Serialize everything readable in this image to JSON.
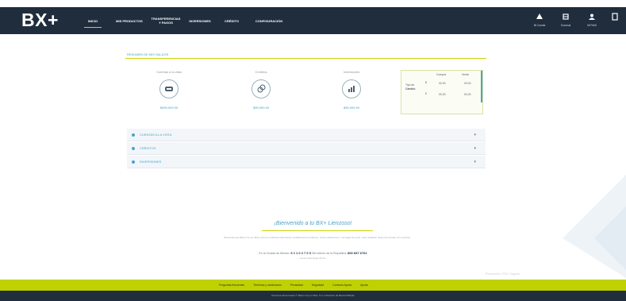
{
  "header": {
    "logo": "BX+",
    "nav": [
      {
        "label": "INICIO"
      },
      {
        "label": "MIS PRODUCTOS"
      },
      {
        "label": "TRANSFERENCIAS Y PAGOS"
      },
      {
        "label": "INVERSIONES"
      },
      {
        "label": "CRÉDITO"
      },
      {
        "label": "CONFIGURACIÓN"
      }
    ],
    "icons": [
      {
        "icon": "user-icon",
        "label": "Mi Cuenta"
      },
      {
        "icon": "building-icon",
        "label": "Sucursal"
      },
      {
        "icon": "profile-icon",
        "label": "Mi Perfil"
      },
      {
        "icon": "exit-icon",
        "label": ""
      }
    ]
  },
  "summary": {
    "title": "RESUMEN DE MIS SALDOS",
    "stats": [
      {
        "label": "Cuentas a la vista",
        "value": "$999,999.99",
        "icon": "wallet-icon"
      },
      {
        "label": "Créditos",
        "value": "$99,999.99",
        "icon": "coins-icon"
      },
      {
        "label": "Inversiones",
        "value": "$99,999.99",
        "icon": "chart-icon"
      }
    ],
    "table": {
      "col1": "Compra",
      "col2": "Venta",
      "row_label1": "Tipo de",
      "row_label2": "Cambio",
      "cur1": "$",
      "cur2": "€",
      "buy1": "00.00",
      "sell1": "00.00",
      "buy2": "00.00",
      "sell2": "00.00"
    }
  },
  "accordion": [
    {
      "label": "CUENTAS A LA VISTA"
    },
    {
      "label": "CRÉDITOS"
    },
    {
      "label": "INVERSIONES"
    }
  ],
  "footer": {
    "welcome": "¡Bienvenido a tu BX+ Lienzoso!",
    "disclaimer": "Recuerda que Banco Ve por Más nunca te solicitará información confidencial por teléfono, correo electrónico o mensajes de texto. Ante cualquier duda comunícate con nosotros.",
    "phone_prefix": "En la Ciudad de México:",
    "phone1": "5 1 1 0 2 7 0 0",
    "phone_mid": "Del interior de la República:",
    "phone2": "800 837 6762",
    "phone_sub": "Lunes a Domingo 24 hrs.",
    "watermark": "Protección ITEC Seguro",
    "links": [
      "Preguntas frecuentes",
      "Términos y condiciones",
      "Privacidad",
      "Seguridad",
      "Contacto Ayuda",
      "Ayuda"
    ],
    "copyright": "Derechos Reservados © Banco Ve por Más, S.A. Institución de Banca Múltiple"
  }
}
